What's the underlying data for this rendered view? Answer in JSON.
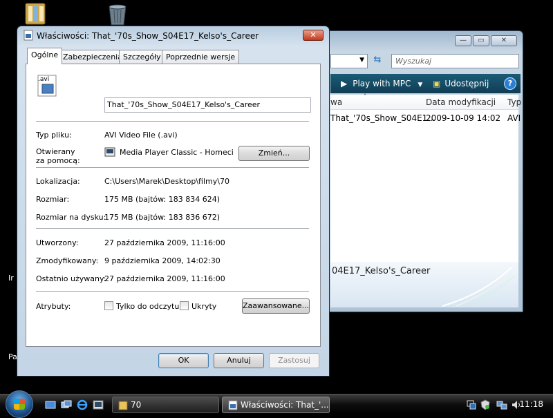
{
  "desktop": {
    "partial_label_1": "Ir",
    "partial_label_2": "Pa"
  },
  "explorer": {
    "min_glyph": "—",
    "max_glyph": "▭",
    "close_glyph": "✕",
    "search_placeholder": "Wyszukaj",
    "toolbar": {
      "play_label": "Play with MPC",
      "share_label": "Udostępnij",
      "help_glyph": "?"
    },
    "columns": [
      "wa",
      "Data modyfikacji",
      "Typ"
    ],
    "row": {
      "name": "That_'70s_Show_S04E1...",
      "date": "2009-10-09 14:02",
      "type": "AVI"
    },
    "scroll_grip": "|||",
    "detail_name": "04E17_Kelso's_Career"
  },
  "dialog": {
    "title": "Właściwości: That_'70s_Show_S04E17_Kelso's_Career",
    "close_glyph": "✕",
    "tabs": [
      "Ogólne",
      "Zabezpieczenia",
      "Szczegóły",
      "Poprzednie wersje"
    ],
    "file_icon_text": ".avi",
    "file_name": "That_'70s_Show_S04E17_Kelso's_Career",
    "fields": {
      "type_label": "Typ pliku:",
      "type_value": "AVI Video File (.avi)",
      "opens_label_1": "Otwierany",
      "opens_label_2": "za pomocą:",
      "opens_value": "Media Player Classic - Homecinema",
      "change_button": "Zmień...",
      "location_label": "Lokalizacja:",
      "location_value": "C:\\Users\\Marek\\Desktop\\filmy\\70",
      "size_label": "Rozmiar:",
      "size_value": "175 MB (bajtów: 183 834 624)",
      "disk_label": "Rozmiar na dysku:",
      "disk_value": "175 MB (bajtów: 183 836 672)",
      "created_label": "Utworzony:",
      "created_value": "27 października 2009, 11:16:00",
      "modified_label": "Zmodyfikowany:",
      "modified_value": "9 października 2009, 14:02:30",
      "accessed_label": "Ostatnio używany:",
      "accessed_value": "27 października 2009, 11:16:00",
      "attributes_label": "Atrybuty:",
      "readonly_label": "Tylko do odczytu",
      "hidden_label": "Ukryty",
      "advanced_button": "Zaawansowane..."
    },
    "buttons": {
      "ok": "OK",
      "cancel": "Anuluj",
      "apply": "Zastosuj"
    }
  },
  "taskbar": {
    "tasks": [
      {
        "label": "70"
      },
      {
        "label": "Właściwości: That_'..."
      }
    ],
    "clock": "11:18"
  }
}
